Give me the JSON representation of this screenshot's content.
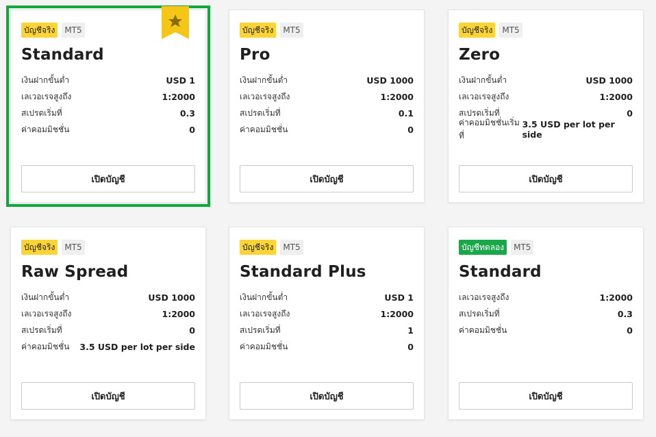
{
  "colors": {
    "selected_outline": "#0fa83a",
    "real_badge": "#fcd535",
    "demo_badge": "#18a84a",
    "ribbon": "#f5c518"
  },
  "cards": [
    {
      "badge": "บัญชีจริง",
      "badge_kind": "real",
      "platform": "MT5",
      "title": "Standard",
      "selected": true,
      "favorite_icon": "star-icon",
      "rows": [
        {
          "label": "เงินฝากขั้นต่ำ",
          "value": "USD 1"
        },
        {
          "label": "เลเวอเรจสูงถึง",
          "value": "1:2000"
        },
        {
          "label": "สเปรดเริ่มที่",
          "value": "0.3"
        },
        {
          "label": "ค่าคอมมิชชั่น",
          "value": "0"
        }
      ],
      "button": "เปิดบัญชี"
    },
    {
      "badge": "บัญชีจริง",
      "badge_kind": "real",
      "platform": "MT5",
      "title": "Pro",
      "rows": [
        {
          "label": "เงินฝากขั้นต่ำ",
          "value": "USD 1000"
        },
        {
          "label": "เลเวอเรจสูงถึง",
          "value": "1:2000"
        },
        {
          "label": "สเปรดเริ่มที่",
          "value": "0.1"
        },
        {
          "label": "ค่าคอมมิชชั่น",
          "value": "0"
        }
      ],
      "button": "เปิดบัญชี"
    },
    {
      "badge": "บัญชีจริง",
      "badge_kind": "real",
      "platform": "MT5",
      "title": "Zero",
      "rows": [
        {
          "label": "เงินฝากขั้นต่ำ",
          "value": "USD 1000"
        },
        {
          "label": "เลเวอเรจสูงถึง",
          "value": "1:2000"
        },
        {
          "label": "สเปรดเริ่มที่",
          "value": "0"
        },
        {
          "label": "ค่าคอมมิชชั่นเริ่มที่",
          "value": "3.5 USD per lot per side"
        }
      ],
      "button": "เปิดบัญชี"
    },
    {
      "badge": "บัญชีจริง",
      "badge_kind": "real",
      "platform": "MT5",
      "title": "Raw Spread",
      "rows": [
        {
          "label": "เงินฝากขั้นต่ำ",
          "value": "USD 1000"
        },
        {
          "label": "เลเวอเรจสูงถึง",
          "value": "1:2000"
        },
        {
          "label": "สเปรดเริ่มที่",
          "value": "0"
        },
        {
          "label": "ค่าคอมมิชชั่น",
          "value": "3.5 USD per lot per side"
        }
      ],
      "button": "เปิดบัญชี"
    },
    {
      "badge": "บัญชีจริง",
      "badge_kind": "real",
      "platform": "MT5",
      "title": "Standard Plus",
      "rows": [
        {
          "label": "เงินฝากขั้นต่ำ",
          "value": "USD 1"
        },
        {
          "label": "เลเวอเรจสูงถึง",
          "value": "1:2000"
        },
        {
          "label": "สเปรดเริ่มที่",
          "value": "1"
        },
        {
          "label": "ค่าคอมมิชชั่น",
          "value": "0"
        }
      ],
      "button": "เปิดบัญชี"
    },
    {
      "badge": "บัญชีทดลอง",
      "badge_kind": "demo",
      "platform": "MT5",
      "title": "Standard",
      "rows": [
        {
          "label": "เลเวอเรจสูงถึง",
          "value": "1:2000"
        },
        {
          "label": "สเปรดเริ่มที่",
          "value": "0.3"
        },
        {
          "label": "ค่าคอมมิชชั่น",
          "value": "0"
        }
      ],
      "button": "เปิดบัญชี"
    }
  ]
}
